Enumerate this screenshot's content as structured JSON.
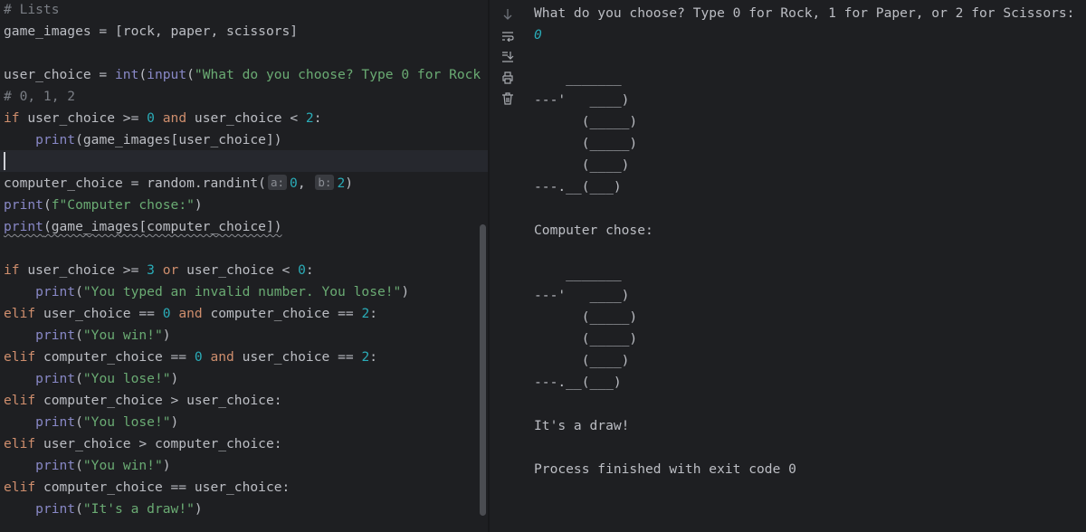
{
  "editor": {
    "lines": [
      "# Lists",
      "game_images = [rock, paper, scissors]",
      "",
      "user_choice = int(input(\"What do you choose? Type 0 for Rock",
      "# 0, 1, 2",
      "if user_choice >= 0 and user_choice < 2:",
      "    print(game_images[user_choice])",
      "",
      "computer_choice = random.randint(a: 0, b: 2)",
      "print(f\"Computer chose:\")",
      "print(game_images[computer_choice])",
      "",
      "if user_choice >= 3 or user_choice < 0:",
      "    print(\"You typed an invalid number. You lose!\")",
      "elif user_choice == 0 and computer_choice == 2:",
      "    print(\"You win!\")",
      "elif computer_choice == 0 and user_choice == 2:",
      "    print(\"You lose!\")",
      "elif computer_choice > user_choice:",
      "    print(\"You lose!\")",
      "elif user_choice > computer_choice:",
      "    print(\"You win!\")",
      "elif computer_choice == user_choice:",
      "    print(\"It's a draw!\")"
    ],
    "param_hints": [
      "a:",
      "b:"
    ]
  },
  "toolbar": {
    "icons": [
      "scroll-down-icon",
      "soft-wrap-icon",
      "scroll-to-end-icon",
      "print-icon",
      "trash-icon"
    ]
  },
  "console": {
    "prompt": "What do you choose? Type 0 for Rock, 1 for Paper, or 2 for Scissors:",
    "user_input": "0",
    "rock_art": [
      "    _______",
      "---'   ____)",
      "      (_____)",
      "      (_____)",
      "      (____)",
      "---.__(___)"
    ],
    "computer_label": "Computer chose:",
    "computer_art": [
      "    _______",
      "---'   ____)",
      "      (_____)",
      "      (_____)",
      "      (____)",
      "---.__(___)"
    ],
    "result": "It's a draw!",
    "exit_message": "Process finished with exit code 0"
  },
  "colors": {
    "background": "#1e1f22",
    "keyword": "#cf8e6d",
    "builtin": "#8888c6",
    "string": "#6aab73",
    "number": "#2aacb8",
    "comment": "#7a7e85",
    "text": "#bcbec4"
  }
}
